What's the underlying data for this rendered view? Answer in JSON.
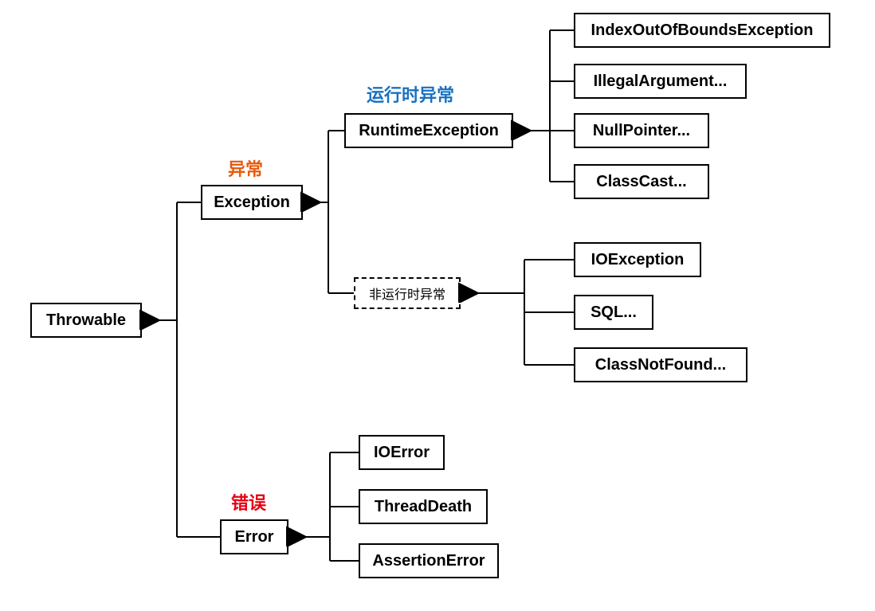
{
  "annotations": {
    "runtime_label": {
      "text": "运行时异常",
      "color": "#1971C2"
    },
    "exception_label": {
      "text": "异常",
      "color": "#E8590C"
    },
    "error_label": {
      "text": "错误",
      "color": "#E60012"
    }
  },
  "nodes": {
    "throwable": "Throwable",
    "exception": "Exception",
    "runtime_exception": "RuntimeException",
    "non_runtime": "非运行时异常",
    "error": "Error",
    "runtime_children": [
      "IndexOutOfBoundsException",
      "IllegalArgument...",
      "NullPointer...",
      "ClassCast..."
    ],
    "non_runtime_children": [
      "IOException",
      "SQL...",
      "ClassNotFound..."
    ],
    "error_children": [
      "IOError",
      "ThreadDeath",
      "AssertionError"
    ]
  },
  "chart_data": {
    "type": "tree",
    "title": "",
    "root": {
      "name": "Throwable",
      "children": [
        {
          "name": "Exception",
          "annotation": "异常",
          "children": [
            {
              "name": "RuntimeException",
              "annotation": "运行时异常",
              "children": [
                {
                  "name": "IndexOutOfBoundsException"
                },
                {
                  "name": "IllegalArgument..."
                },
                {
                  "name": "NullPointer..."
                },
                {
                  "name": "ClassCast..."
                }
              ]
            },
            {
              "name": "非运行时异常",
              "style": "dashed",
              "children": [
                {
                  "name": "IOException"
                },
                {
                  "name": "SQL..."
                },
                {
                  "name": "ClassNotFound..."
                }
              ]
            }
          ]
        },
        {
          "name": "Error",
          "annotation": "错误",
          "children": [
            {
              "name": "IOError"
            },
            {
              "name": "ThreadDeath"
            },
            {
              "name": "AssertionError"
            }
          ]
        }
      ]
    }
  }
}
